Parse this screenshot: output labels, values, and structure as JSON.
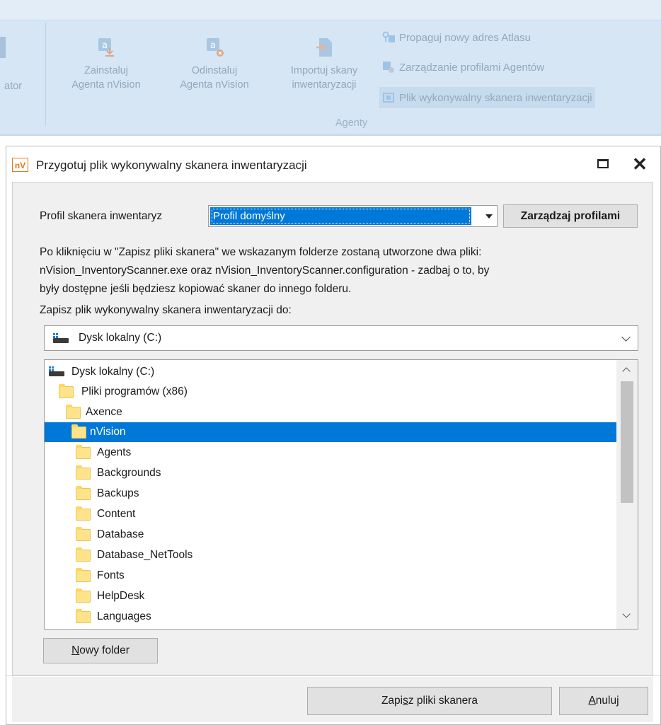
{
  "ribbon": {
    "cut_left_label_1": "ator",
    "cut_left_label_2": "",
    "install": {
      "line1": "Zainstaluj",
      "line2": "Agenta nVision"
    },
    "uninstall": {
      "line1": "Odinstaluj",
      "line2": "Agenta nVision"
    },
    "import": {
      "line1": "Importuj skany",
      "line2": "inwentaryzacji"
    },
    "group_label": "Agenty",
    "small": [
      "Propaguj nowy adres Atlasu",
      "Zarządzanie profilami Agentów",
      "Plik wykonywalny skanera inwentaryzacji"
    ]
  },
  "dialog": {
    "app_icon_text": "nV",
    "title": "Przygotuj plik wykonywalny skanera inwentaryzacji",
    "profile_label": "Profil skanera inwentaryz",
    "profile_value": "Profil domyślny",
    "manage_profiles": "Zarządzaj profilami",
    "paragraph_line1": "Po kliknięciu w \"Zapisz pliki skanera\" we wskazanym folderze zostaną utworzone dwa pliki:",
    "paragraph_line2": "nVision_InventoryScanner.exe oraz nVision_InventoryScanner.configuration - zadbaj o to, by",
    "paragraph_line3": "były dostępne jeśli będziesz kopiować skaner do innego folderu.",
    "save_to_label": "Zapisz plik wykonywalny skanera inwentaryzacji do:",
    "drive_combo": "Dysk lokalny (C:)",
    "tree": {
      "drive": "Dysk lokalny (C:)",
      "program_files": "Pliki programów (x86)",
      "axence": "Axence",
      "nvision": "nVision",
      "children": [
        "Agents",
        "Backgrounds",
        "Backups",
        "Content",
        "Database",
        "Database_NetTools",
        "Fonts",
        "HelpDesk",
        "Languages"
      ]
    },
    "new_folder_pre": "",
    "new_folder_u": "N",
    "new_folder_post": "owy folder",
    "save_pre": "Zapi",
    "save_u": "s",
    "save_post": "z pliki skanera",
    "cancel_pre": "",
    "cancel_u": "A",
    "cancel_post": "nuluj"
  }
}
